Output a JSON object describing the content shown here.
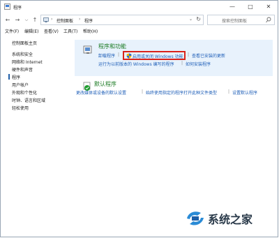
{
  "window": {
    "title": "程序"
  },
  "address": {
    "crumbs": [
      "控制面板",
      "程序"
    ],
    "search_placeholder": "搜索控制面板"
  },
  "menu": [
    "文件(F)",
    "编辑(E)",
    "查看(V)",
    "工具(T)",
    "帮助(H)"
  ],
  "sidebar": {
    "items": [
      {
        "label": "控制面板主页"
      },
      {
        "label": "系统和安全"
      },
      {
        "label": "网络和 Internet"
      },
      {
        "label": "硬件和声音"
      },
      {
        "label": "程序"
      },
      {
        "label": "用户帐户"
      },
      {
        "label": "外观和个性化"
      },
      {
        "label": "时钟、语言和区域"
      },
      {
        "label": "轻松使用"
      }
    ]
  },
  "main": {
    "programs": {
      "heading": "程序和功能",
      "links_row1": [
        "卸载程序",
        "启用或关闭 Windows 功能",
        "查看已安装的更新"
      ],
      "links_row2": [
        "运行为以前版本的 Windows 编写的程序",
        "如何安装程序"
      ]
    },
    "defaults": {
      "heading": "默认程序",
      "links": [
        "更改媒体或设备的默认设置",
        "始终使用指定的程序打开此种文件类型",
        "设置默认程序"
      ]
    }
  },
  "watermark": {
    "text": "系统之家"
  },
  "colors": {
    "link": "#1f5fb8",
    "heading": "#1a7a22",
    "highlight": "#d9241b",
    "panel": "#e8f2fc"
  }
}
